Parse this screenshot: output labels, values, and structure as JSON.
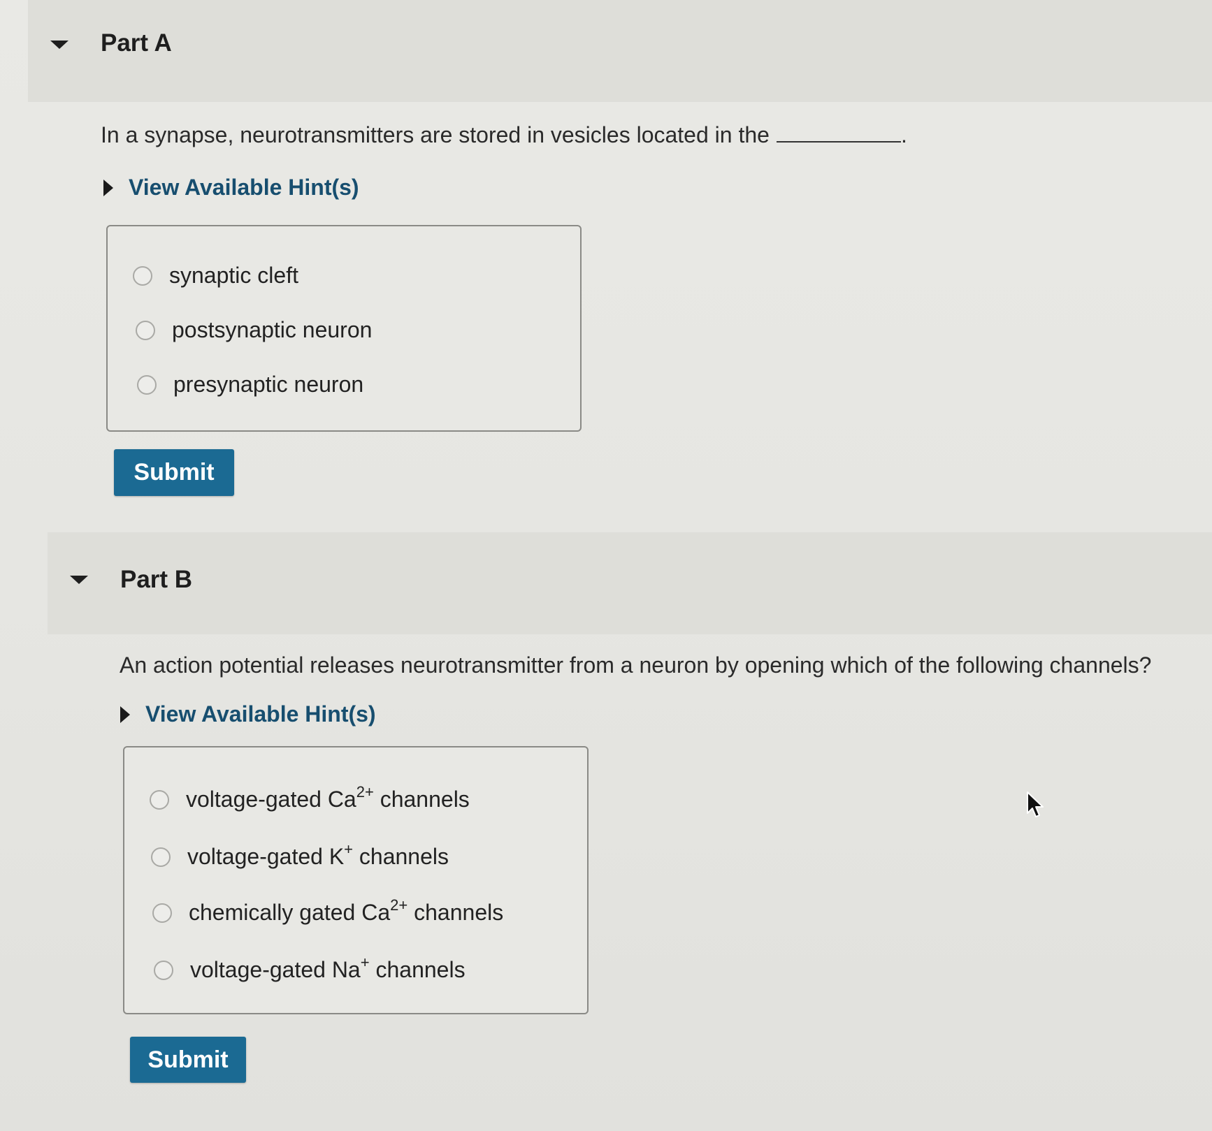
{
  "partA": {
    "title": "Part A",
    "question": "In a synapse, neurotransmitters are stored in vesicles located in the",
    "question_end": ".",
    "hint_label": "View Available Hint(s)",
    "options": [
      {
        "label": "synaptic cleft"
      },
      {
        "label": "postsynaptic neuron"
      },
      {
        "label": "presynaptic neuron"
      }
    ],
    "submit_label": "Submit"
  },
  "partB": {
    "title": "Part B",
    "question": "An action potential releases neurotransmitter from a neuron by opening which of the following channels?",
    "hint_label": "View Available Hint(s)",
    "options": [
      {
        "pre": "voltage-gated Ca",
        "sup": "2+",
        "post": " channels"
      },
      {
        "pre": "voltage-gated K",
        "sup": "+",
        "post": " channels"
      },
      {
        "pre": "chemically gated Ca",
        "sup": "2+",
        "post": " channels"
      },
      {
        "pre": "voltage-gated Na",
        "sup": "+",
        "post": " channels"
      }
    ],
    "submit_label": "Submit"
  },
  "colors": {
    "accent": "#1b6a93",
    "hint_text": "#174e6f",
    "header_bg": "#deded9"
  },
  "icons": [
    "caret-down-icon",
    "caret-right-icon",
    "radio-icon",
    "mouse-pointer-icon"
  ]
}
